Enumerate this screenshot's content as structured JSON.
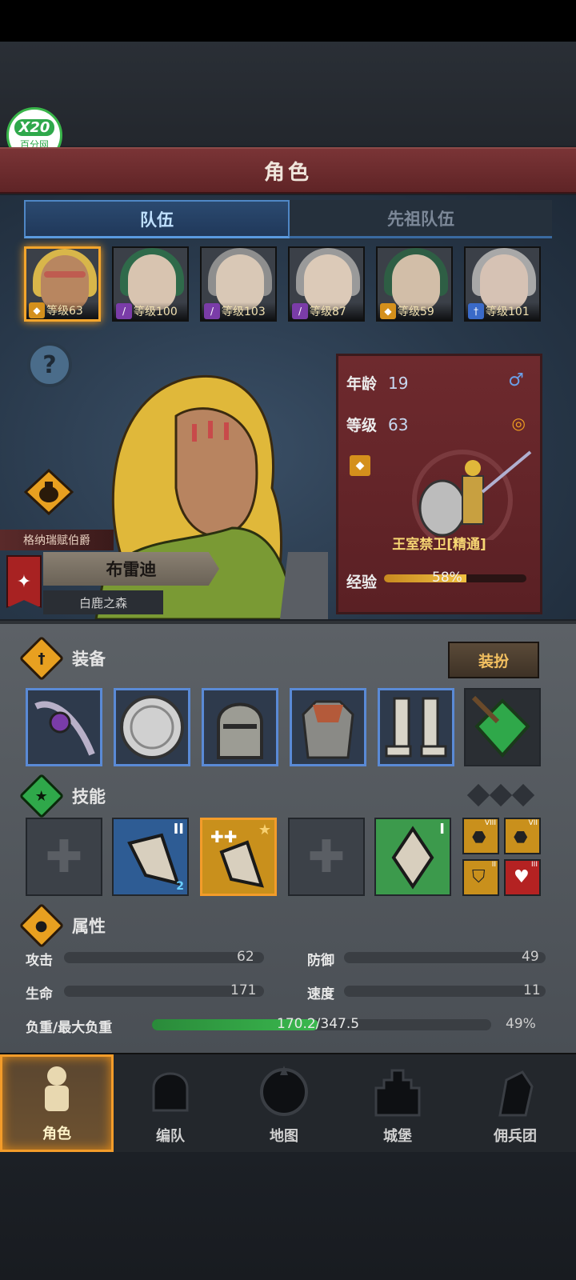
{
  "watermark": {
    "line1": "X20",
    "line2": "百分网"
  },
  "title": "角色",
  "tabs": [
    {
      "label": "队伍"
    },
    {
      "label": "先祖队伍"
    }
  ],
  "heroes": [
    {
      "level": "等级63",
      "class_icon": "shield-icon",
      "selected": true
    },
    {
      "level": "等级100",
      "class_icon": "staff-icon",
      "selected": false
    },
    {
      "level": "等级103",
      "class_icon": "staff-icon",
      "selected": false
    },
    {
      "level": "等级87",
      "class_icon": "staff-icon",
      "selected": false
    },
    {
      "level": "等级59",
      "class_icon": "shield-icon",
      "selected": false
    },
    {
      "level": "等级101",
      "class_icon": "sword-icon",
      "selected": false
    }
  ],
  "character": {
    "nobility": "格纳瑞赋伯爵",
    "name": "布雷迪",
    "region": "白鹿之森",
    "age_label": "年龄",
    "age": "19",
    "level_label": "等级",
    "level": "63",
    "unit": "王室禁卫[精通]",
    "exp_label": "经验",
    "exp_percent": 58,
    "exp_text": "58%"
  },
  "equipment": {
    "title": "装备",
    "dress_button": "装扮",
    "items": [
      "staff-icon",
      "round-shield-icon",
      "helmet-icon",
      "armor-icon",
      "boots-icon",
      "emerald-amulet-icon"
    ]
  },
  "skills": {
    "title": "技能",
    "slots": [
      {
        "type": "empty"
      },
      {
        "type": "skill",
        "rank": "II",
        "badge": "2",
        "color": "#2e5c94"
      },
      {
        "type": "skill",
        "rank": "",
        "color": "#c9901c"
      },
      {
        "type": "empty"
      },
      {
        "type": "skill",
        "rank": "I",
        "color": "#3c9a4c"
      }
    ],
    "passives": [
      {
        "rank": "VIII",
        "color": "#c9901c"
      },
      {
        "rank": "VII",
        "color": "#c9901c"
      },
      {
        "rank": "II",
        "color": "#c9901c"
      },
      {
        "rank": "III",
        "color": "#b42222"
      }
    ]
  },
  "attributes": {
    "title": "属性",
    "attack_label": "攻击",
    "attack": "62",
    "defense_label": "防御",
    "defense": "49",
    "hp_label": "生命",
    "hp": "171",
    "speed_label": "速度",
    "speed": "11",
    "load_label": "负重/最大负重",
    "load_text": "170.2/347.5",
    "load_percent": 49,
    "load_percent_text": "49%"
  },
  "nav": [
    {
      "label": "角色",
      "icon": "knight-icon",
      "active": true
    },
    {
      "label": "编队",
      "icon": "helmet-formation-icon",
      "active": false
    },
    {
      "label": "地图",
      "icon": "compass-map-icon",
      "active": false
    },
    {
      "label": "城堡",
      "icon": "castle-icon",
      "active": false
    },
    {
      "label": "佣兵团",
      "icon": "mercenary-icon",
      "active": false
    }
  ],
  "colors": {
    "accent": "#f39c2a",
    "tab_blue": "#4f87c6",
    "title_red": "#7a3436",
    "load_green": "#3aa84a"
  }
}
